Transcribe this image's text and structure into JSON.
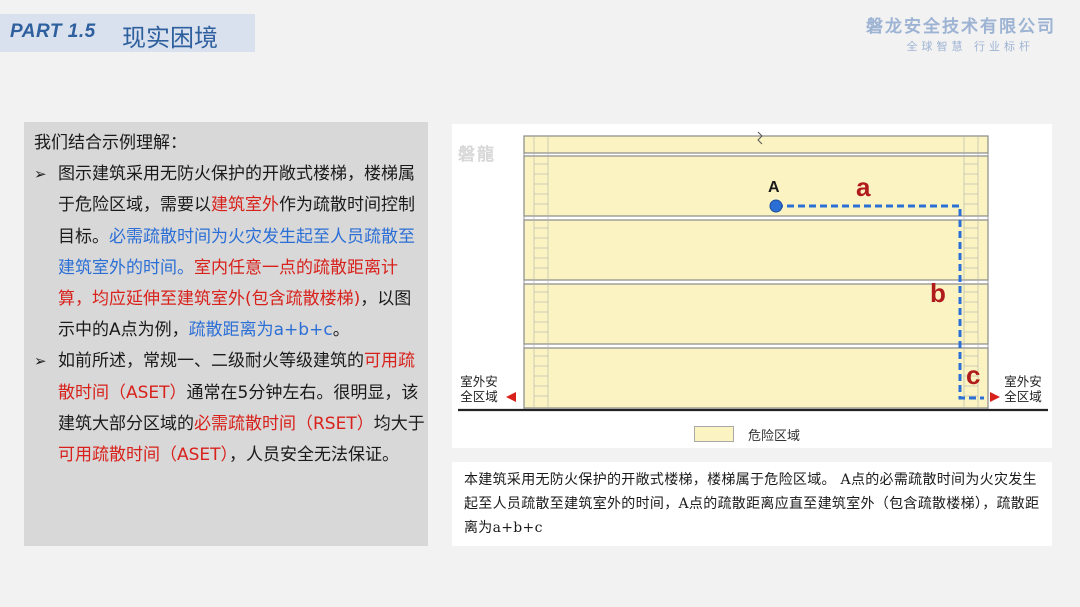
{
  "header": {
    "part_number": "PART 1.5",
    "title": "现实困境",
    "company_name": "磐龙安全技术有限公司",
    "company_slogan": "全球智慧 行业标杆"
  },
  "left_panel": {
    "intro": "我们结合示例理解：",
    "bullet_marker": "➢",
    "bullet1": {
      "t1": "图示建筑采用无防火保护的开敞式楼梯，楼梯属于危险区域，需要以",
      "t2": "建筑室外",
      "t3": "作为疏散时间控制目标。",
      "t4": "必需疏散时间为火灾发生起至人员疏散至建筑室外的时间。",
      "t5": "室内任意一点的疏散距离计算，均应延伸至建筑室外(包含疏散楼梯)",
      "t6": "，以图示中的A点为例，",
      "t7": "疏散距离为a+b+c",
      "t8": "。"
    },
    "bullet2": {
      "t1": "如前所述，常规一、二级耐火等级建筑的",
      "t2": "可用疏散时间（ASET）",
      "t3": "通常在5分钟左右。很明显，该建筑大部分区域的",
      "t4": "必需疏散时间（RSET）",
      "t5": "均大于",
      "t6": "可用疏散时间（ASET）",
      "t7": "，人员安全无法保证。"
    }
  },
  "diagram": {
    "watermark": "磐龍",
    "point_label": "A",
    "segment_a": "a",
    "segment_b": "b",
    "segment_c": "c",
    "safe_zone_left": "室外安全区域",
    "safe_zone_right": "室外安全区域",
    "legend_label": "危险区域",
    "colors": {
      "danger_fill": "#fbf4c2",
      "path": "#2b6fd6",
      "arrow": "#d9211b",
      "segment_label": "#b01b1b"
    }
  },
  "caption": {
    "text": "本建筑采用无防火保护的开敞式楼梯，楼梯属于危险区域。 A点的必需疏散时间为火灾发生起至人员疏散至建筑室外的时间，A点的疏散距离应直至建筑室外（包含疏散楼梯），疏散距离为a+b+c"
  }
}
